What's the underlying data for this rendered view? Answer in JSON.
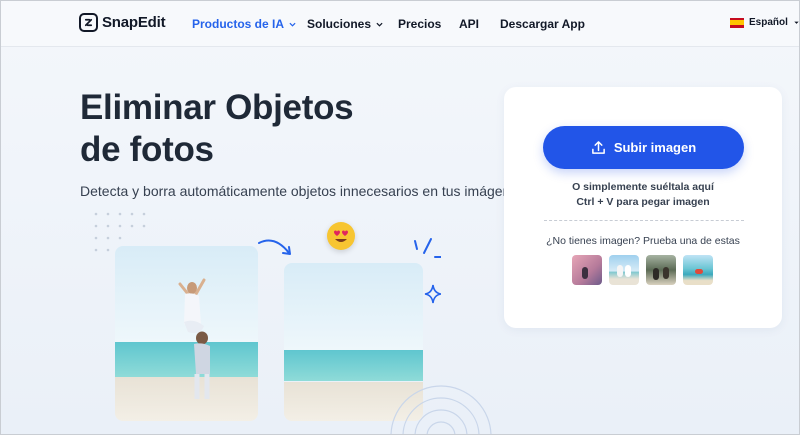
{
  "header": {
    "brand": "SnapEdit",
    "nav": [
      {
        "label": "Productos de IA",
        "active": true,
        "dropdown": true
      },
      {
        "label": "Soluciones",
        "active": false,
        "dropdown": true
      },
      {
        "label": "Precios",
        "active": false,
        "dropdown": false
      },
      {
        "label": "API",
        "active": false,
        "dropdown": false
      },
      {
        "label": "Descargar App",
        "active": false,
        "dropdown": false
      }
    ],
    "language": "Español"
  },
  "hero": {
    "title_line1": "Eliminar Objetos",
    "title_line2": "de fotos",
    "subtitle": "Detecta y borra automáticamente objetos innecesarios en tus imágenes"
  },
  "upload_card": {
    "button_label": "Subir imagen",
    "hint_drop": "O simplemente suéltala aquí",
    "hint_paste": "Ctrl + V para pegar imagen",
    "samples_title": "¿No tienes imagen? Prueba una de estas"
  },
  "icons": {
    "logo": "snapedit-logo-icon",
    "upload": "upload-icon",
    "chevron": "chevron-down-icon",
    "flag": "spain-flag-icon",
    "emoji": "heart-eyes-emoji-icon",
    "arrow": "curved-arrow-icon",
    "sparkle": "sparkle-icon"
  },
  "colors": {
    "accent": "#2255e8",
    "active_nav": "#2563eb",
    "highlight": "#34e3e8",
    "text": "#1f2937"
  }
}
